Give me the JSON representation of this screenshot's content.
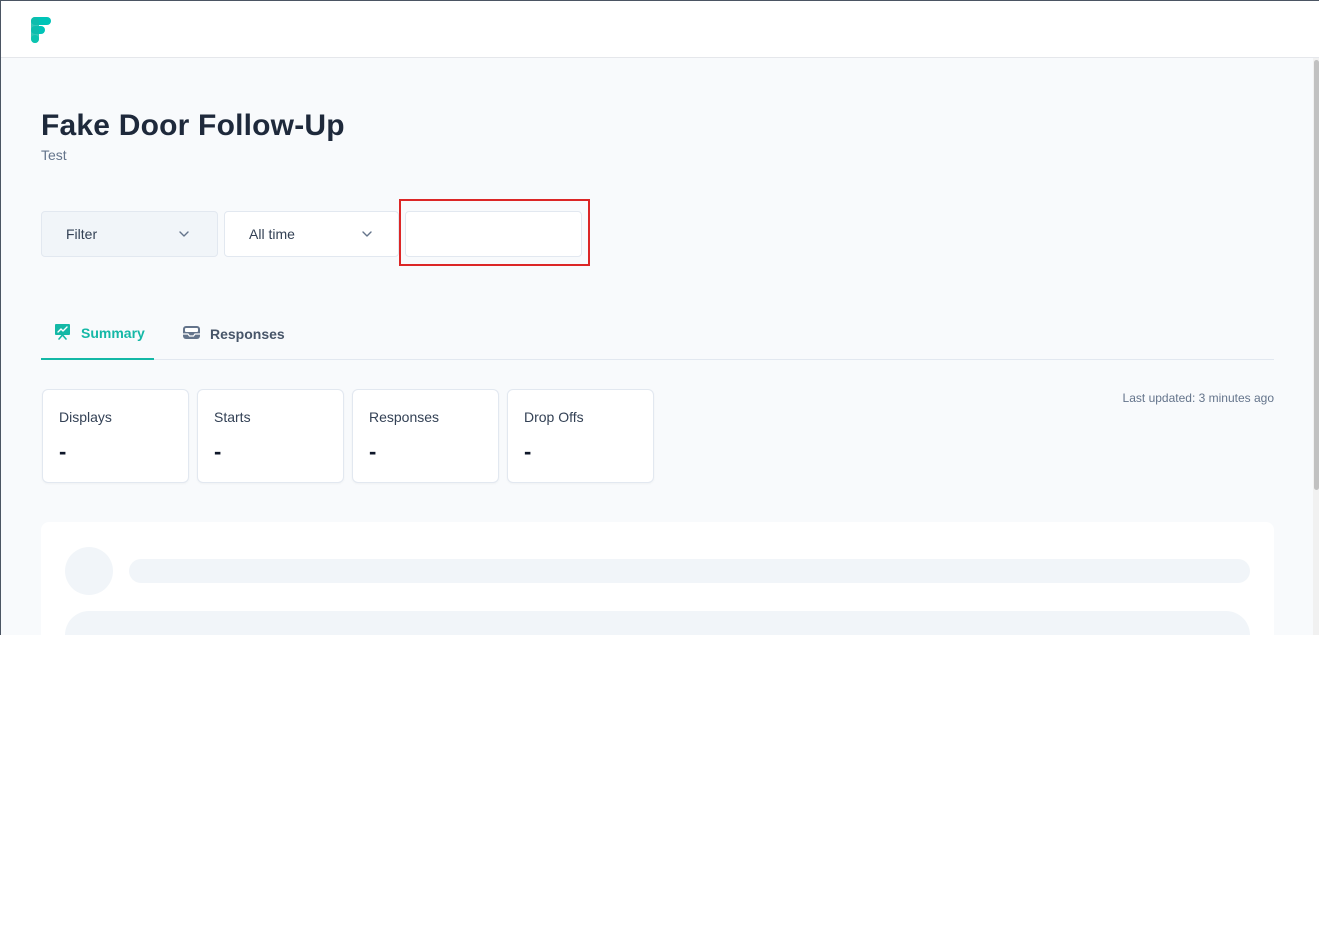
{
  "header": {
    "logo_icon": "formbricks-logo-icon"
  },
  "page": {
    "title": "Fake Door Follow-Up",
    "subtitle": "Test"
  },
  "filters": {
    "filter_label": "Filter",
    "time_label": "All time",
    "date_range_value": ""
  },
  "tabs": [
    {
      "label": "Summary",
      "icon": "presentation-chart-icon",
      "active": true
    },
    {
      "label": "Responses",
      "icon": "inbox-stack-icon",
      "active": false
    }
  ],
  "stats": [
    {
      "label": "Displays",
      "value": "-"
    },
    {
      "label": "Starts",
      "value": "-"
    },
    {
      "label": "Responses",
      "value": "-"
    },
    {
      "label": "Drop Offs",
      "value": "-"
    }
  ],
  "last_updated": "Last updated: 3 minutes ago",
  "colors": {
    "accent": "#14b8a6",
    "highlight": "#dc2626",
    "background": "#f8fafc"
  }
}
